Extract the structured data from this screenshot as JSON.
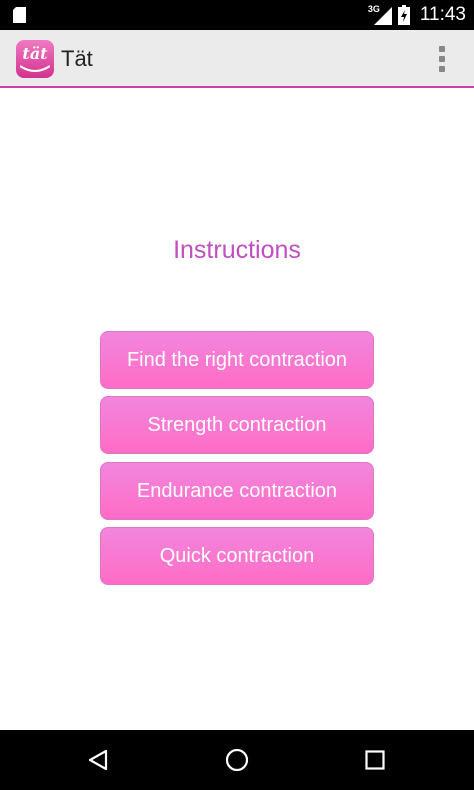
{
  "status_bar": {
    "network_type": "3G",
    "time": "11:43",
    "icons": [
      "sd-card-icon",
      "signal-icon",
      "battery-charging-icon"
    ]
  },
  "action_bar": {
    "logo_text": "tät",
    "title": "Tät",
    "menu_icon": "overflow-menu-icon"
  },
  "main": {
    "heading": "Instructions",
    "buttons": [
      {
        "label": "Find the right contraction"
      },
      {
        "label": "Strength contraction"
      },
      {
        "label": "Endurance contraction"
      },
      {
        "label": "Quick contraction"
      }
    ]
  },
  "nav_bar": {
    "icons": [
      "back-icon",
      "home-icon",
      "recents-icon"
    ]
  },
  "colors": {
    "accent": "#d13fa6",
    "heading": "#c24fc0",
    "button_top": "#f286dd",
    "button_bottom": "#ff6cc6",
    "action_bar_bg": "#ebebeb"
  }
}
